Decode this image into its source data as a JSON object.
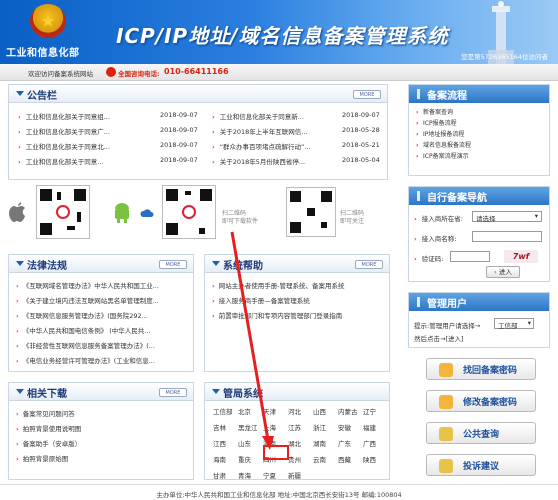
{
  "header": {
    "ministry": "工业和信息化部",
    "title": "ICP/IP地址/域名信息备案管理系统",
    "user_welcome": "您是第5726365164位访问者"
  },
  "subbar": {
    "welcome": "欢迎访问备案系统网站",
    "phone_label": "全国咨询电话:",
    "phone_number": "010-66411166"
  },
  "notice": {
    "title": "公告栏",
    "more": "MORE",
    "items": [
      {
        "text": "工业和信息化部关于同意组...",
        "date": "2018-09-07"
      },
      {
        "text": "工业和信息化部关于同意广...",
        "date": "2018-09-07"
      },
      {
        "text": "工业和信息化部关于同意北...",
        "date": "2018-09-07"
      },
      {
        "text": "工业和信息化部关于同意...",
        "date": "2018-09-07"
      },
      {
        "text": "工业和信息化部关于同意新...",
        "date": "2018-09-07"
      },
      {
        "text": "关于2018年上半年互联网信...",
        "date": "2018-05-28"
      },
      {
        "text": "“群众办事百项堵点疏解行动”...",
        "date": "2018-05-21"
      },
      {
        "text": "关于2018年5月份陕西省停...",
        "date": "2018-05-04"
      }
    ]
  },
  "downloads": {
    "scan_download": [
      "扫二维码",
      "即可下载软件"
    ],
    "scan_follow": [
      "扫二维码",
      "即可关注"
    ]
  },
  "flow": {
    "title": "备案流程",
    "items": [
      "新备案查询",
      "ICP报备流程",
      "IP地址报备流程",
      "域名信息报备流程",
      "ICP备案流程演示"
    ]
  },
  "nav": {
    "title": "自行备案导航",
    "isp_label": "接入商所在省:",
    "isp_value": "请选择",
    "name_label": "接入商名称:",
    "code_label": "验证码:",
    "code_value": "7wf",
    "enter": "进入"
  },
  "admin": {
    "title": "管理用户",
    "prompt": "提示:管理用户请选择→",
    "dept": "工信部",
    "confirm": "然后点击→[进入]"
  },
  "law": {
    "title": "法律法规",
    "more": "MORE",
    "items": [
      "《互联网域名管理办法》中华人民共和国工业...",
      "《关于建立境内违法互联网站黑名单管理制度...",
      "《互联网信息服务管理办法》(国务院292...",
      "《中华人民共和国电信条例》 (中华人民共...",
      "《非经营性互联网信息服务备案管理办法》(...",
      "《电信业务经营许可管理办法》(工业和信息..."
    ]
  },
  "help": {
    "title": "系统帮助",
    "more": "MORE",
    "items": [
      "网站主办者使用手册-管理系统、备案用系统",
      "接入服务商手册—备案管理系统",
      "前置审批部门和专项内容管理部门登录指南"
    ]
  },
  "related": {
    "title": "相关下载",
    "more": "MORE",
    "items": [
      "备案常见问题问答",
      "拍照背景使用说明图",
      "备案助手（安卓版）",
      "拍照背景原始图"
    ]
  },
  "bureau": {
    "title": "管局系统",
    "rows": [
      [
        "工信部",
        "北京",
        "天津",
        "河北",
        "山西",
        "内蒙古",
        "辽宁"
      ],
      [
        "吉林",
        "黑龙江",
        "上海",
        "江苏",
        "浙江",
        "安徽",
        "福建"
      ],
      [
        "江西",
        "山东",
        "河南",
        "湖北",
        "湖南",
        "广东",
        "广西"
      ],
      [
        "海南",
        "重庆",
        "四川",
        "贵州",
        "云南",
        "西藏",
        "陕西"
      ],
      [
        "甘肃",
        "青海",
        "宁夏",
        "新疆"
      ]
    ]
  },
  "actions": {
    "retrieve": "找回备案密码",
    "modify": "修改备案密码",
    "query": "公共查询",
    "complain": "投诉建议"
  },
  "footer": {
    "text": "主办单位:中华人民共和国工业和信息化部 地址:中国北京西长安街13号 邮编:100804"
  }
}
